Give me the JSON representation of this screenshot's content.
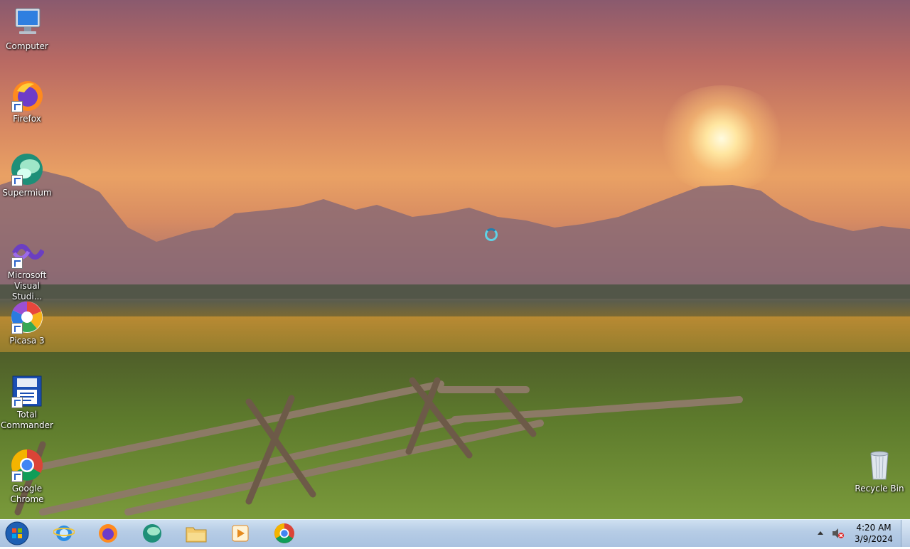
{
  "desktop_icons": [
    {
      "label": "Computer",
      "icon": "computer-icon"
    },
    {
      "label": "Firefox",
      "icon": "firefox-icon"
    },
    {
      "label": "Supermium",
      "icon": "supermium-icon"
    },
    {
      "label": "Microsoft Visual Studi...",
      "icon": "visual-studio-icon"
    },
    {
      "label": "Picasa 3",
      "icon": "picasa-icon"
    },
    {
      "label": "Total Commander",
      "icon": "total-commander-icon"
    },
    {
      "label": "Google Chrome",
      "icon": "chrome-icon"
    },
    {
      "label": "Recycle Bin",
      "icon": "recycle-bin-icon"
    }
  ],
  "taskbar": {
    "pinned": [
      "internet-explorer-icon",
      "firefox-icon",
      "supermium-icon",
      "file-explorer-icon",
      "media-player-icon",
      "chrome-icon"
    ],
    "clock": {
      "time": "4:20 AM",
      "date": "3/9/2024"
    }
  },
  "colors": {
    "taskbar": "#b7cde6",
    "accent": "#2a62c8"
  }
}
